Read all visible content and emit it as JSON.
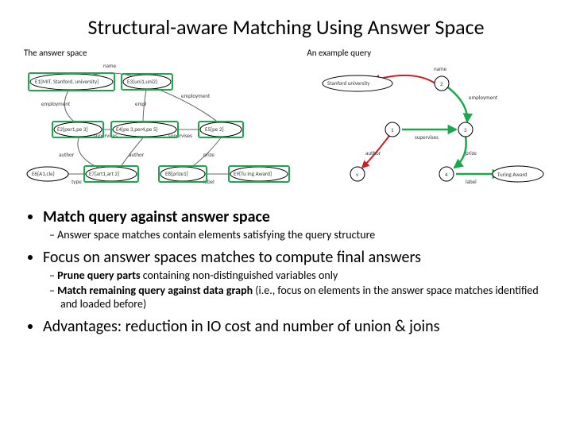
{
  "title": "Structural-aware Matching Using Answer Space",
  "subheads": {
    "left": "The answer space",
    "right": "An example query"
  },
  "answer_space": {
    "nodes": {
      "e1": "E1{MIT, Stanford, university}",
      "e2": "E2{per1,pe 3}",
      "e3": "E3{uni1,uni2}",
      "e4": "E4{pe 3,per4,pe 5}",
      "e5": "E5{pe 2}",
      "e6": "E6{A1,cle}",
      "e7": "E7{art1,art 2}",
      "e8": "E8{prize1}",
      "e9": "E9{Tu ing Award}"
    },
    "edges": {
      "name1": "name",
      "empl1": "employment",
      "empl2": "empl",
      "empl3": "employment",
      "sup1": "supervises",
      "sup2": "supervises",
      "auth1": "author",
      "auth2": "author",
      "prize": "prize",
      "type": "type",
      "label": "label"
    }
  },
  "query": {
    "nodes": {
      "q0": "Stanford university",
      "q1": "1",
      "q2": "2",
      "q3": "3",
      "q4": "4",
      "q5": "Turing Award"
    },
    "edges": {
      "name": "name",
      "empl": "employment",
      "sup": "supervises",
      "auth": "author",
      "prize": "prize",
      "label": "label"
    }
  },
  "bullets": {
    "b1_title": "Match query against answer space",
    "b1_sub1": "Answer space matches contain elements satisfying the query structure",
    "b2_title": "Focus on answer spaces matches to compute final answers",
    "b2_sub1_bold": "Prune query parts",
    "b2_sub1_rest": " containing non-distinguished variables only",
    "b2_sub2_bold": "Match remaining query against data graph",
    "b2_sub2_rest": " (i.e., focus on elements in the answer space matches identified and loaded before)",
    "b3_title": "Advantages: reduction in IO cost and number of union & joins"
  }
}
